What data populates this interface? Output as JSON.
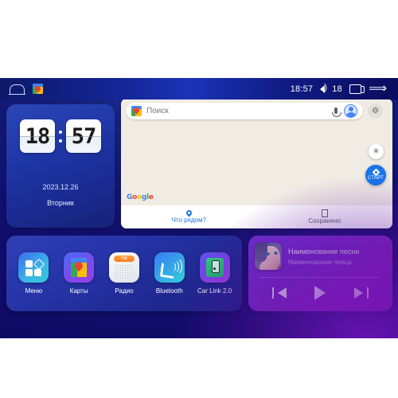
{
  "statusbar": {
    "home_icon": "home-icon",
    "maps_app_icon": "google-maps-icon",
    "time": "18:57",
    "volume_icon": "volume-icon",
    "volume_level": "18",
    "recents_icon": "recents-icon",
    "back_icon": "back-icon"
  },
  "clock_widget": {
    "hours": "18",
    "minutes": "57",
    "date": "2023.12.26",
    "weekday": "Вторник"
  },
  "maps_widget": {
    "search": {
      "placeholder": "Поиск",
      "pin_icon": "maps-pin-icon",
      "mic_icon": "microphone-icon",
      "avatar_icon": "account-avatar-icon",
      "settings_icon": "settings-gear-icon"
    },
    "compass_button": "compass-icon",
    "start_button_label": "СТАРТ",
    "google_logo": {
      "g": "G",
      "o1": "o",
      "o2": "o",
      "g2": "g",
      "l": "l",
      "e": "e"
    },
    "tabs": [
      {
        "label": "Что рядом?",
        "icon": "pin-icon",
        "active": true
      },
      {
        "label": "Сохранено",
        "icon": "bookmark-icon",
        "active": false
      }
    ]
  },
  "apps": [
    {
      "label": "Меню",
      "icon": "apps-grid-icon"
    },
    {
      "label": "Карты",
      "icon": "google-maps-icon"
    },
    {
      "label": "Радио",
      "icon": "radio-icon",
      "band": "FM"
    },
    {
      "label": "Bluetooth",
      "icon": "bluetooth-phone-icon"
    },
    {
      "label": "Car Link 2.0",
      "icon": "car-link-icon"
    }
  ],
  "music_player": {
    "album_art": "album-art-portrait",
    "track_title": "Наименование песни",
    "track_artist": "Наименование певца",
    "controls": {
      "previous": "previous-track-icon",
      "play": "play-icon",
      "next": "next-track-icon"
    }
  },
  "colors": {
    "background_blue": "#131a7a",
    "accent_purple": "#7a2bc8",
    "maps_blue": "#1a73e8",
    "map_surface": "#f0ece4"
  }
}
